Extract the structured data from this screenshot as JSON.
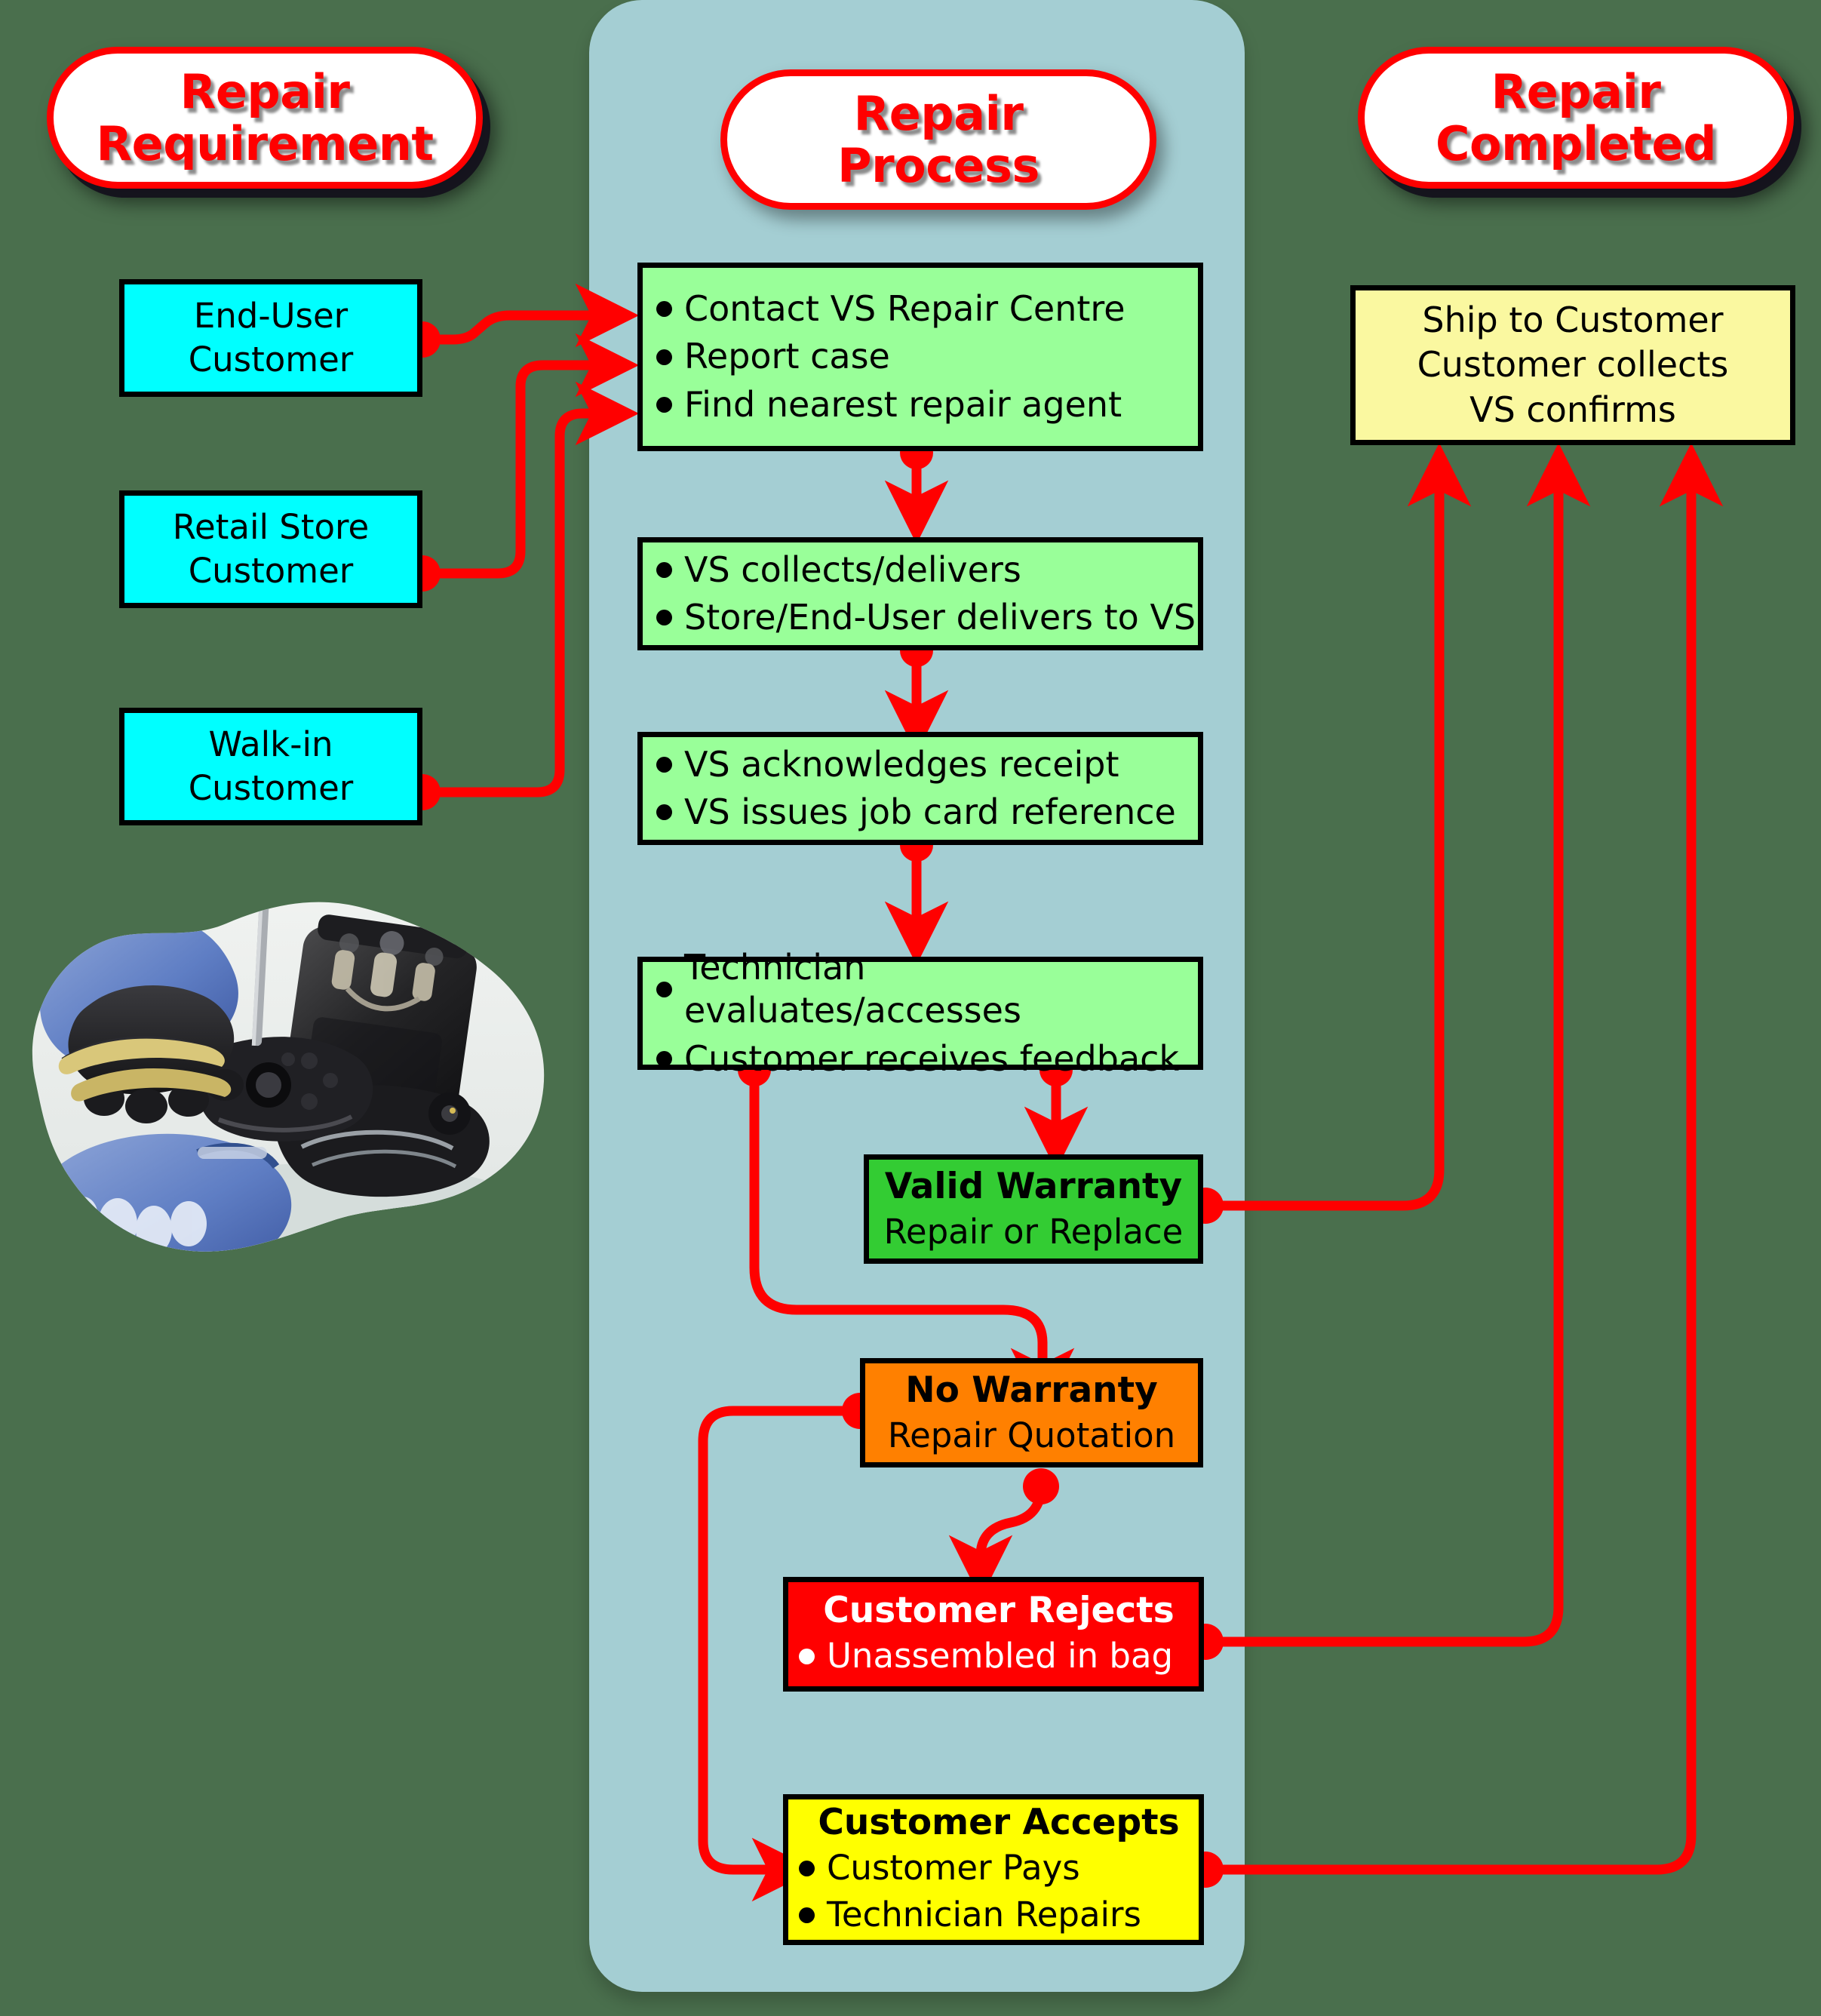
{
  "diagram": {
    "background_color": "#4a6f4d",
    "lane_color": "#a4ced3",
    "connector_color": "#ff0000"
  },
  "headers": [
    {
      "id": "repair-requirement",
      "line1": "Repair",
      "line2": "Requirement"
    },
    {
      "id": "repair-process",
      "line1": "Repair",
      "line2": "Process"
    },
    {
      "id": "repair-completed",
      "line1": "Repair",
      "line2": "Completed"
    }
  ],
  "sources": [
    {
      "id": "end-user-customer",
      "line1": "End-User",
      "line2": "Customer"
    },
    {
      "id": "retail-store-customer",
      "line1": "Retail Store",
      "line2": "Customer"
    },
    {
      "id": "walk-in-customer",
      "line1": "Walk-in",
      "line2": "Customer"
    }
  ],
  "process_steps": [
    {
      "id": "contact-step",
      "bullets": [
        "Contact VS Repair Centre",
        "Report case",
        "Find nearest repair agent"
      ]
    },
    {
      "id": "delivery-step",
      "bullets": [
        "VS collects/delivers",
        "Store/End-User delivers to VS"
      ]
    },
    {
      "id": "acknowledge-step",
      "bullets": [
        "VS acknowledges receipt",
        "VS issues job card reference"
      ]
    },
    {
      "id": "evaluate-step",
      "bullets": [
        "Technician evaluates/accesses",
        "Customer receives feedback"
      ]
    }
  ],
  "decisions": [
    {
      "id": "valid-warranty",
      "title": "Valid Warranty",
      "subtitle": "Repair or Replace",
      "color": "#33cc33"
    },
    {
      "id": "no-warranty",
      "title": "No Warranty",
      "subtitle": "Repair Quotation",
      "color": "#ff8000"
    },
    {
      "id": "customer-rejects",
      "title": "Customer Rejects",
      "bullets": [
        "Unassembled in bag"
      ],
      "color": "#ff0000"
    },
    {
      "id": "customer-accepts",
      "title": "Customer Accepts",
      "bullets": [
        "Customer Pays",
        "Technician Repairs"
      ],
      "color": "#ffff00"
    }
  ],
  "outcome": {
    "id": "repair-outcome",
    "lines": [
      "Ship to Customer",
      "Customer collects",
      "VS confirms"
    ]
  },
  "photo": {
    "id": "technician-repair-photo",
    "alt": "Technician in blue gloves disassembling a power tool with a screwdriver"
  }
}
